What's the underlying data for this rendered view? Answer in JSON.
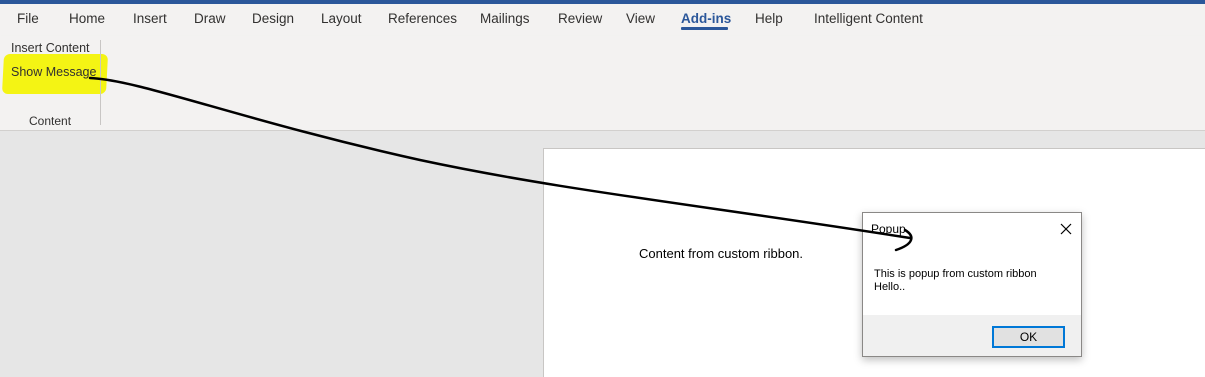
{
  "tabs": [
    {
      "label": "File"
    },
    {
      "label": "Home"
    },
    {
      "label": "Insert"
    },
    {
      "label": "Draw"
    },
    {
      "label": "Design"
    },
    {
      "label": "Layout"
    },
    {
      "label": "References"
    },
    {
      "label": "Mailings"
    },
    {
      "label": "Review"
    },
    {
      "label": "View"
    },
    {
      "label": "Add-ins",
      "active": true
    },
    {
      "label": "Help"
    },
    {
      "label": "Intelligent Content"
    }
  ],
  "ribbon": {
    "insert_content": "Insert Content",
    "show_message": "Show Message",
    "group_label": "Content"
  },
  "document": {
    "text": "Content from custom ribbon."
  },
  "dialog": {
    "title": "Popup",
    "message_line1": "This is popup from custom ribbon",
    "message_line2": "Hello..",
    "ok_label": "OK"
  },
  "colors": {
    "accent": "#2b579a",
    "highlight": "#f4f414",
    "dialog_focus": "#0078d7"
  }
}
